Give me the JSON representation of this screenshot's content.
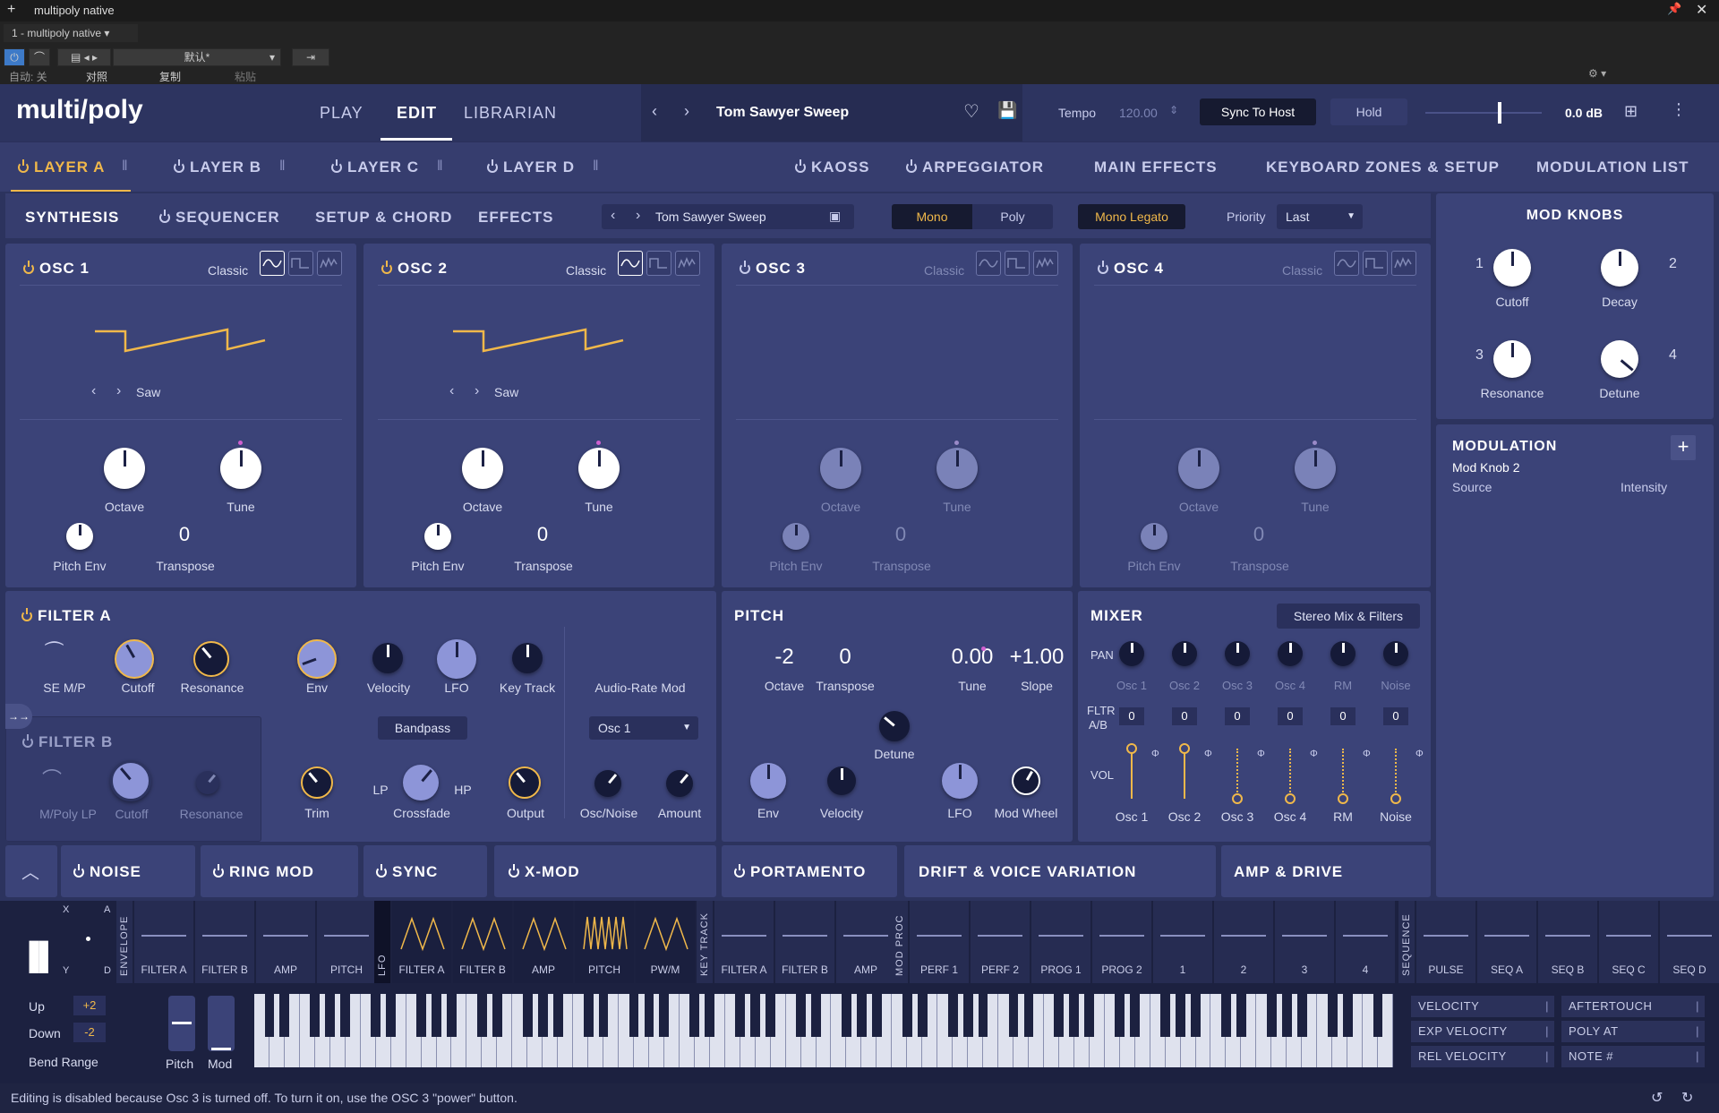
{
  "host": {
    "title": "multipoly native",
    "preset_tab": "1 - multipoly native",
    "preset_name": "默认*",
    "auto_off": "自动: 关",
    "compare": "对照",
    "copy": "复制",
    "paste": "粘贴"
  },
  "nav": {
    "logo": "multi/poly",
    "tabs": [
      "PLAY",
      "EDIT",
      "LIBRARIAN"
    ],
    "preset": "Tom Sawyer Sweep",
    "tempo_label": "Tempo",
    "tempo": "120.00",
    "sync": "Sync To Host",
    "hold": "Hold",
    "volume": "0.0 dB"
  },
  "layers": {
    "items": [
      "LAYER A",
      "LAYER B",
      "LAYER C",
      "LAYER D"
    ],
    "right": [
      "KAOSS",
      "ARPEGGIATOR",
      "MAIN EFFECTS",
      "KEYBOARD ZONES & SETUP",
      "MODULATION LIST"
    ]
  },
  "subtabs": {
    "items": [
      "SYNTHESIS",
      "SEQUENCER",
      "SETUP & CHORD",
      "EFFECTS"
    ],
    "preset": "Tom Sawyer Sweep",
    "mono": "Mono",
    "poly": "Poly",
    "legato": "Mono Legato",
    "priority_label": "Priority",
    "priority": "Last"
  },
  "osc": [
    {
      "title": "OSC 1",
      "type": "Classic",
      "wave": "Saw",
      "octave": "Octave",
      "tune": "Tune",
      "pitch_env": "Pitch Env",
      "transpose": "Transpose",
      "transpose_val": "0"
    },
    {
      "title": "OSC 2",
      "type": "Classic",
      "wave": "Saw",
      "octave": "Octave",
      "tune": "Tune",
      "pitch_env": "Pitch Env",
      "transpose": "Transpose",
      "transpose_val": "0"
    },
    {
      "title": "OSC 3",
      "type": "Classic",
      "wave": "",
      "octave": "Octave",
      "tune": "Tune",
      "pitch_env": "Pitch Env",
      "transpose": "Transpose",
      "transpose_val": "0"
    },
    {
      "title": "OSC 4",
      "type": "Classic",
      "wave": "",
      "octave": "Octave",
      "tune": "Tune",
      "pitch_env": "Pitch Env",
      "transpose": "Transpose",
      "transpose_val": "0"
    }
  ],
  "modknobs": {
    "title": "MOD KNOBS",
    "k1": "Cutoff",
    "k2": "Decay",
    "k3": "Resonance",
    "k4": "Detune",
    "n1": "1",
    "n2": "2",
    "n3": "3",
    "n4": "4"
  },
  "modulation": {
    "title": "MODULATION",
    "target": "Mod Knob 2",
    "source": "Source",
    "intensity": "Intensity"
  },
  "filterA": {
    "title": "FILTER A",
    "se": "SE M/P",
    "cutoff": "Cutoff",
    "res": "Resonance",
    "env": "Env",
    "vel": "Velocity",
    "lfo": "LFO",
    "key": "Key Track",
    "arm": "Audio-Rate Mod",
    "bandpass": "Bandpass",
    "osc": "Osc 1",
    "trim": "Trim",
    "lp": "LP",
    "hp": "HP",
    "cross": "Crossfade",
    "output": "Output",
    "oscnoise": "Osc/Noise",
    "amount": "Amount"
  },
  "filterB": {
    "title": "FILTER B",
    "type": "M/Poly LP",
    "cutoff": "Cutoff",
    "res": "Resonance"
  },
  "pitch": {
    "title": "PITCH",
    "oct_val": "-2",
    "trans_val": "0",
    "tune_val": "0.00",
    "slope_val": "+1.00",
    "oct": "Octave",
    "trans": "Transpose",
    "tune": "Tune",
    "slope": "Slope",
    "detune": "Detune",
    "env": "Env",
    "vel": "Velocity",
    "lfo": "LFO",
    "mw": "Mod Wheel"
  },
  "mixer": {
    "title": "MIXER",
    "mode": "Stereo Mix & Filters",
    "pan": "PAN",
    "fltr": "FLTR",
    "ab": "A/B",
    "vol": "VOL",
    "cols": [
      "Osc 1",
      "Osc 2",
      "Osc 3",
      "Osc 4",
      "RM",
      "Noise"
    ],
    "fvals": [
      "0",
      "0",
      "0",
      "0",
      "0",
      "0"
    ]
  },
  "lower": [
    "NOISE",
    "RING MOD",
    "SYNC",
    "X-MOD",
    "PORTAMENTO",
    "DRIFT & VOICE VARIATION",
    "AMP & DRIVE"
  ],
  "modstrip": {
    "x": "X",
    "a": "A",
    "y": "Y",
    "d": "D",
    "envelope": "ENVELOPE",
    "lfo": "LFO",
    "keytrack": "KEY TRACK",
    "modproc": "MOD PROC",
    "sequence": "SEQUENCE",
    "env": [
      "FILTER A",
      "FILTER B",
      "AMP",
      "PITCH"
    ],
    "lfos": [
      "FILTER A",
      "FILTER B",
      "AMP",
      "PITCH",
      "PW/M"
    ],
    "kt": [
      "FILTER A",
      "FILTER B",
      "AMP"
    ],
    "mp": [
      "PERF 1",
      "PERF 2",
      "PROG 1",
      "PROG 2",
      "1",
      "2",
      "3",
      "4"
    ],
    "seq": [
      "PULSE",
      "SEQ A",
      "SEQ B",
      "SEQ C",
      "SEQ D"
    ]
  },
  "keyboard": {
    "up": "Up",
    "down": "Down",
    "up_val": "+2",
    "down_val": "-2",
    "bend": "Bend Range",
    "pitch": "Pitch",
    "mod": "Mod"
  },
  "modsrc": [
    "VELOCITY",
    "AFTERTOUCH",
    "EXP VELOCITY",
    "POLY AT",
    "REL VELOCITY",
    "NOTE #"
  ],
  "status": "Editing is disabled because Osc 3 is turned off. To turn it on, use the OSC 3 \"power\" button.",
  "colors": {
    "accent": "#f0b84a",
    "panel": "#3b4378",
    "bg": "#2c335e"
  }
}
